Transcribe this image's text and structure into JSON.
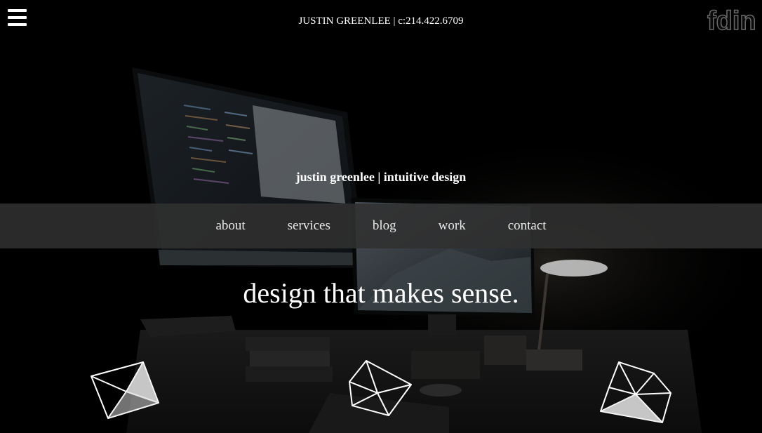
{
  "header": {
    "contact": "JUSTIN GREENLEE | c:214.422.6709",
    "logo_text": "fdin"
  },
  "hero": {
    "tagline": "justin greenlee | intuitive design",
    "headline": "design that makes sense."
  },
  "nav": {
    "items": [
      {
        "label": "about"
      },
      {
        "label": "services"
      },
      {
        "label": "blog"
      },
      {
        "label": "work"
      },
      {
        "label": "contact"
      }
    ]
  },
  "icons": {
    "menu": "hamburger-menu-icon",
    "gems": [
      "geometric-gem-icon",
      "geometric-gem-icon",
      "geometric-gem-icon"
    ]
  },
  "colors": {
    "background": "#000000",
    "nav_background": "#303030",
    "text": "#ffffff",
    "nav_text": "#e8e8e8"
  }
}
